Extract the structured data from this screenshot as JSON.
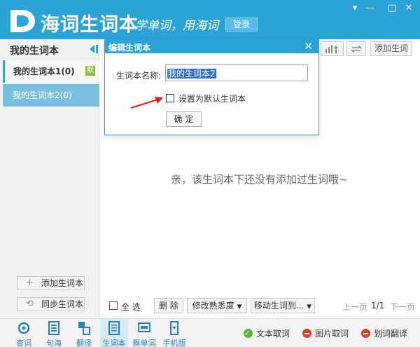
{
  "app": {
    "logo_text": "海词生词本",
    "slogan": "学单词，用海词",
    "login_label": "登录",
    "window_controls": [
      "▾",
      "—",
      "□",
      "✕"
    ]
  },
  "sidebar": {
    "title": "我的生词本",
    "books": [
      {
        "label": "我的生词本1(0)",
        "badge": "默"
      },
      {
        "label": "我的生词本2(0)"
      }
    ],
    "add_label": "添加生词本",
    "sync_label": "同步生词本"
  },
  "toolbar": {
    "add_word_label": "添加生词"
  },
  "main": {
    "empty_message": "亲，该生词本下还没有添加过生词哦~"
  },
  "bottom_bar": {
    "select_all_label": "全 选",
    "delete_label": "删 除",
    "familiarity_label": "修改熟悉度",
    "move_label": "移动生词到...",
    "prev_label": "上一页",
    "page_info": "1/1",
    "next_label": "下一页"
  },
  "footer": {
    "nav": [
      {
        "label": "查词",
        "icon": "search-icon"
      },
      {
        "label": "句海",
        "icon": "document-icon"
      },
      {
        "label": "翻译",
        "icon": "translate-icon"
      },
      {
        "label": "生词本",
        "icon": "notebook-icon"
      },
      {
        "label": "飘单词",
        "icon": "floating-word-icon"
      },
      {
        "label": "手机版",
        "icon": "mobile-icon"
      }
    ],
    "tools": [
      {
        "label": "文本取词",
        "status": "on"
      },
      {
        "label": "图片取词",
        "status": "off"
      },
      {
        "label": "划词翻译",
        "status": "off"
      }
    ]
  },
  "dialog": {
    "title": "编辑生词本",
    "name_label": "生词本名称:",
    "name_value": "我的生词本2",
    "default_checkbox_label": "设置为默认生词本",
    "default_checked": false,
    "ok_label": "确定"
  },
  "colors": {
    "brand": "#2ba3d6",
    "selected_item": "#78c0dd",
    "badge": "#8fbf3c",
    "arrow": "#e02020"
  }
}
